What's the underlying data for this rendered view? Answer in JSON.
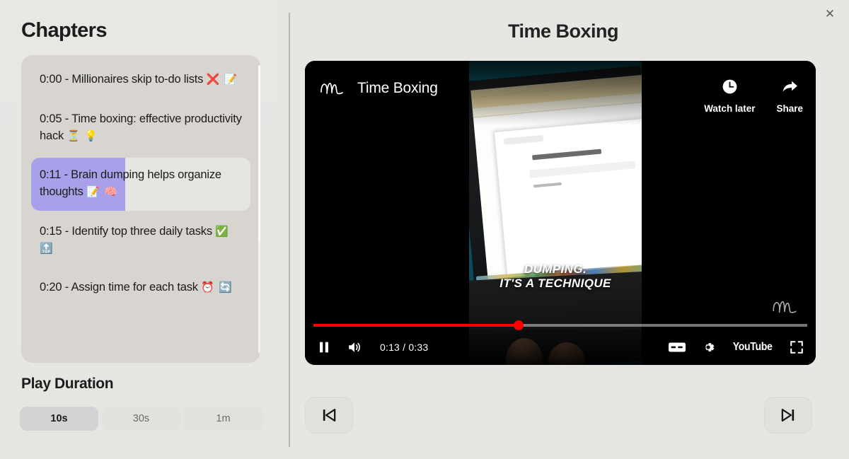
{
  "window": {
    "close_label": "✕"
  },
  "sidebar": {
    "title": "Chapters",
    "chapters": [
      {
        "time": "0:00",
        "text": "0:00 - Millionaires skip to-do lists",
        "emoji": "❌ 📝",
        "active": false
      },
      {
        "time": "0:05",
        "text": "0:05 - Time boxing: effective productivity hack",
        "emoji": "⏳ 💡",
        "active": false
      },
      {
        "time": "0:11",
        "text": "0:11 - Brain dumping helps organize thoughts",
        "emoji": "📝 🧠",
        "active": true
      },
      {
        "time": "0:15",
        "text": "0:15 - Identify top three daily tasks",
        "emoji": "✅ 🔝",
        "active": false
      },
      {
        "time": "0:20",
        "text": "0:20 - Assign time for each task",
        "emoji": "⏰ 🔄",
        "active": false
      }
    ],
    "duration": {
      "title": "Play Duration",
      "options": [
        {
          "label": "10s",
          "selected": true
        },
        {
          "label": "30s",
          "selected": false
        },
        {
          "label": "1m",
          "selected": false
        }
      ]
    },
    "accent_color": "#a8a0e8"
  },
  "main": {
    "title": "Time Boxing",
    "player": {
      "brand_name": "Time Boxing",
      "watch_later_label": "Watch later",
      "share_label": "Share",
      "time_current": "0:13",
      "time_total": "0:33",
      "time_display": "0:13 / 0:33",
      "progress_percent": 41.5,
      "progress_color": "#ff0000",
      "youtube_label": "YouTube",
      "state": "playing",
      "caption_line1": "DUMPING.",
      "caption_line2": "IT'S A TECHNIQUE"
    },
    "nav": {
      "prev_label": "previous",
      "next_label": "next"
    }
  }
}
